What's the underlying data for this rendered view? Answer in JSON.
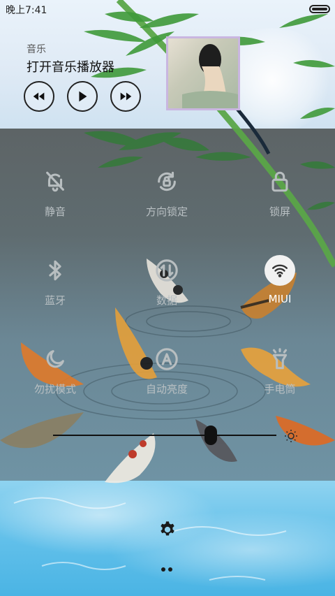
{
  "status_bar": {
    "time": "晚上7:41"
  },
  "music": {
    "section_label": "音乐",
    "title": "打开音乐播放器",
    "controls": [
      "previous",
      "play",
      "next"
    ]
  },
  "toggles": [
    {
      "label": "静音",
      "icon": "bell-off-icon",
      "active": false
    },
    {
      "label": "方向锁定",
      "icon": "rotation-lock-icon",
      "active": false
    },
    {
      "label": "锁屏",
      "icon": "lock-icon",
      "active": false
    },
    {
      "label": "蓝牙",
      "icon": "bluetooth-icon",
      "active": false
    },
    {
      "label": "数据",
      "icon": "data-arrows-icon",
      "active": false
    },
    {
      "label": "MIUI",
      "icon": "wifi-icon",
      "active": true
    },
    {
      "label": "勿扰模式",
      "icon": "moon-icon",
      "active": false
    },
    {
      "label": "自动亮度",
      "icon": "auto-brightness-icon",
      "active": false
    },
    {
      "label": "手电筒",
      "icon": "flashlight-icon",
      "active": false
    }
  ],
  "brightness": {
    "level_percent": 72
  },
  "pager": {
    "pages": 2
  },
  "colors": {
    "active_toggle_bg": "#f2f2f2",
    "inactive_icon": "#b8bec0"
  }
}
